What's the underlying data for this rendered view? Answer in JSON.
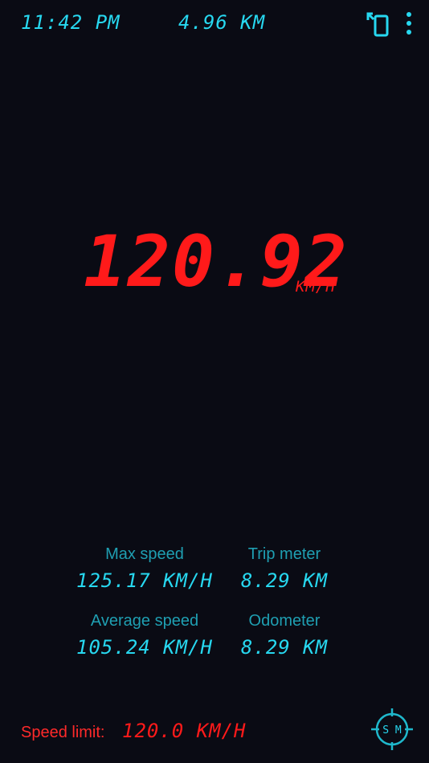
{
  "header": {
    "clock": "11:42 PM",
    "distance": "4.96 KM",
    "rotate_icon": "rotate-screen-icon",
    "menu_icon": "more-vertical-icon"
  },
  "speed": {
    "value": "120.92",
    "unit": "KM/H"
  },
  "stats": {
    "max_speed": {
      "label": "Max speed",
      "value": "125.17 KM/H"
    },
    "trip_meter": {
      "label": "Trip meter",
      "value": "8.29 KM"
    },
    "average_speed": {
      "label": "Average speed",
      "value": "105.24 KM/H"
    },
    "odometer": {
      "label": "Odometer",
      "value": "8.29 KM"
    }
  },
  "footer": {
    "speed_limit_label": "Speed limit:",
    "speed_limit_value": "120.0 KM/H",
    "mode_button_text": "S M",
    "mode_icon": "crosshair-icon"
  },
  "colors": {
    "background": "#0a0b14",
    "accent_cyan": "#27d8f0",
    "label_cyan": "#1f9fb2",
    "speed_red": "#ff1a1a"
  }
}
